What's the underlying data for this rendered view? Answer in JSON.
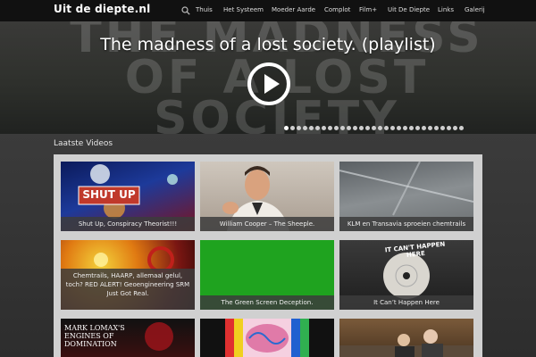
{
  "site": {
    "brand": "Uit de diepte.nl"
  },
  "nav": {
    "items": [
      "Thuis",
      "Het Systeem",
      "Moeder Aarde",
      "Complot",
      "Film+",
      "Uit De Diepte",
      "Links",
      "Galerij"
    ]
  },
  "hero": {
    "bg_lines": [
      "THE MADNESS",
      "OF A LOST",
      "SOCIETY"
    ],
    "title": "The madness of a lost society. (playlist)",
    "slides_total": 29,
    "active_slide": 1
  },
  "section": {
    "title": "Laatste Videos"
  },
  "videos": [
    {
      "caption": "Shut Up, Conspiracy Theorist!!!",
      "overlay": "SHUT UP"
    },
    {
      "caption": "William Cooper – The Sheeple."
    },
    {
      "caption": "KLM en Transavia sproeien chemtrails"
    },
    {
      "caption": "Chemtrails, HAARP, allemaal gelul, toch? RED ALERT! Geoengineering SRM Just Got Real."
    },
    {
      "caption": "The Green Screen Deception."
    },
    {
      "caption": "It Can’t Happen Here",
      "overlay": "IT CAN'T HAPPEN HERE"
    },
    {
      "caption": "",
      "overlay": "MARK LOMAX'S ENGINES OF DOMINATION"
    },
    {
      "caption": ""
    },
    {
      "caption": ""
    }
  ],
  "colors": {
    "navbar": "#111111",
    "panel": "#d0d0d0",
    "caption_bg": "#3c3c3c",
    "green_screen": "#1fa31f"
  }
}
